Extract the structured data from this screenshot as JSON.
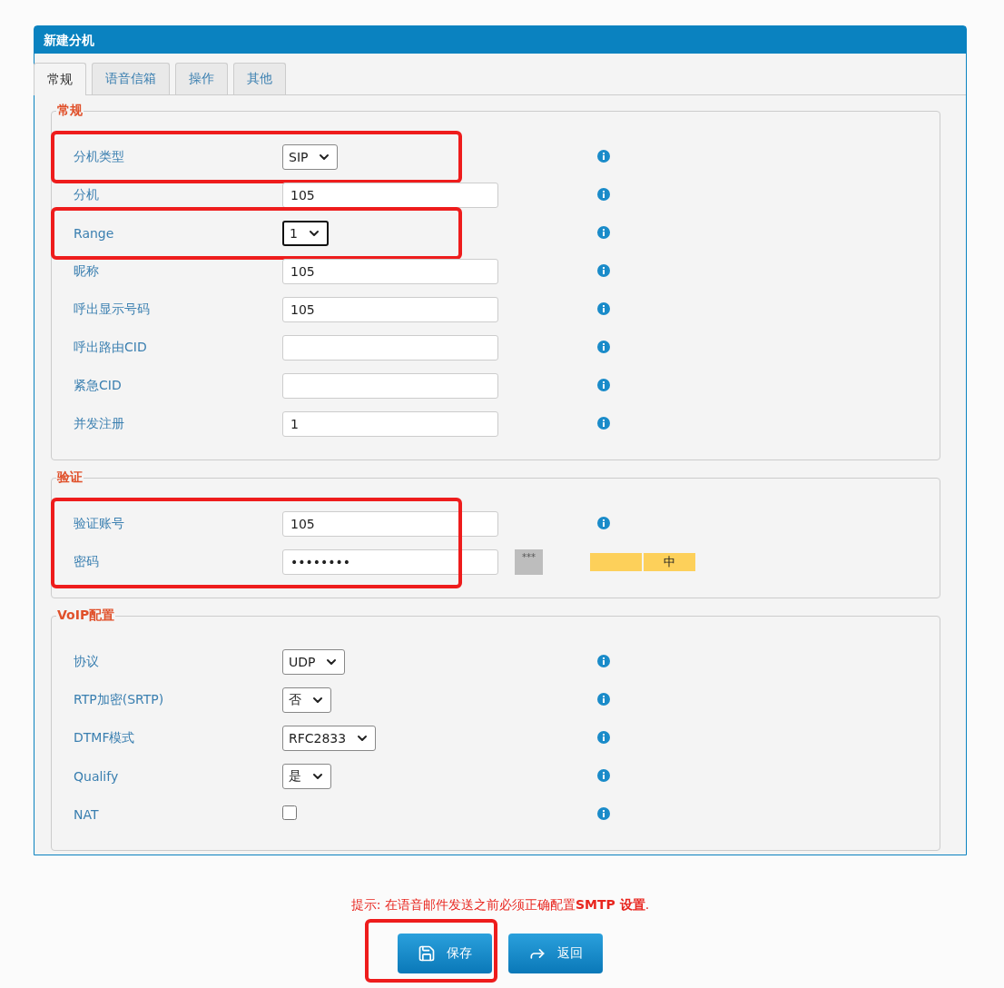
{
  "window": {
    "title": "新建分机"
  },
  "tabs": [
    {
      "label": "常规",
      "selected": true
    },
    {
      "label": "语音信箱",
      "selected": false
    },
    {
      "label": "操作",
      "selected": false
    },
    {
      "label": "其他",
      "selected": false
    }
  ],
  "sections": [
    {
      "legend": "常规",
      "fields": [
        {
          "label": "分机类型",
          "kind": "select",
          "value": "SIP",
          "focused": false,
          "info": true,
          "highlighted": true
        },
        {
          "label": "分机",
          "kind": "text",
          "value": "105",
          "info": true,
          "highlighted": false
        },
        {
          "label": "Range",
          "kind": "select",
          "value": "1",
          "focused": true,
          "info": true,
          "highlighted": true
        },
        {
          "label": "昵称",
          "kind": "text",
          "value": "105",
          "info": true,
          "highlighted": false
        },
        {
          "label": "呼出显示号码",
          "kind": "text",
          "value": "105",
          "info": true,
          "highlighted": false
        },
        {
          "label": "呼出路由CID",
          "kind": "text",
          "info": true,
          "highlighted": false
        },
        {
          "label": "紧急CID",
          "kind": "text",
          "info": true,
          "highlighted": false
        },
        {
          "label": "并发注册",
          "kind": "text",
          "value": "1",
          "info": true,
          "highlighted": false
        }
      ]
    },
    {
      "legend": "验证",
      "fields": [
        {
          "label": "验证账号",
          "kind": "text",
          "value": "105",
          "info": true,
          "highlighted": true
        },
        {
          "label": "密码",
          "kind": "password",
          "value": "••••••••",
          "mask_toggle": "***",
          "strength": [
            {
              "on": true
            },
            {
              "on": true,
              "text": "中"
            }
          ],
          "info": false,
          "highlighted": true
        }
      ]
    },
    {
      "legend": "VoIP配置",
      "fields": [
        {
          "label": "协议",
          "kind": "select",
          "value": "UDP",
          "focused": false,
          "info": true,
          "highlighted": false
        },
        {
          "label": "RTP加密(SRTP)",
          "kind": "select",
          "value": "否",
          "focused": false,
          "info": true,
          "highlighted": false
        },
        {
          "label": "DTMF模式",
          "kind": "select",
          "value": "RFC2833",
          "focused": false,
          "info": true,
          "highlighted": false
        },
        {
          "label": "Qualify",
          "kind": "select",
          "value": "是",
          "focused": false,
          "info": true,
          "highlighted": false
        },
        {
          "label": "NAT",
          "kind": "checkbox",
          "checked": false,
          "info": true,
          "highlighted": false
        }
      ]
    }
  ],
  "hint": "提示: 在语音邮件发送之前必须正确配置**SMTP 设置**.",
  "buttons": [
    {
      "label": "保存",
      "kind": "save",
      "highlighted": true
    },
    {
      "label": "返回",
      "kind": "back",
      "highlighted": false
    }
  ]
}
